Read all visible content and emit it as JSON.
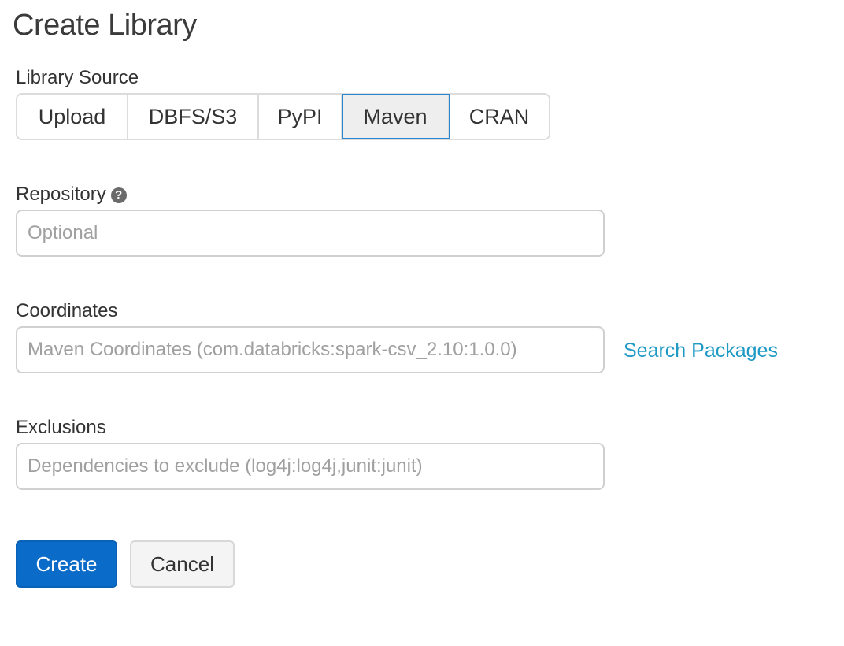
{
  "page": {
    "title": "Create Library"
  },
  "library_source": {
    "label": "Library Source",
    "options": [
      {
        "label": "Upload",
        "active": false
      },
      {
        "label": "DBFS/S3",
        "active": false
      },
      {
        "label": "PyPI",
        "active": false
      },
      {
        "label": "Maven",
        "active": true
      },
      {
        "label": "CRAN",
        "active": false
      }
    ],
    "selected": "Maven"
  },
  "repository": {
    "label": "Repository",
    "help_icon": "question-circle-icon",
    "value": "",
    "placeholder": "Optional"
  },
  "coordinates": {
    "label": "Coordinates",
    "value": "",
    "placeholder": "Maven Coordinates (com.databricks:spark-csv_2.10:1.0.0)",
    "search_link": "Search Packages"
  },
  "exclusions": {
    "label": "Exclusions",
    "value": "",
    "placeholder": "Dependencies to exclude (log4j:log4j,junit:junit)"
  },
  "actions": {
    "create_label": "Create",
    "cancel_label": "Cancel"
  },
  "colors": {
    "primary": "#0b6bc8",
    "link": "#1f9ac5",
    "active_border": "#2a86cf"
  }
}
